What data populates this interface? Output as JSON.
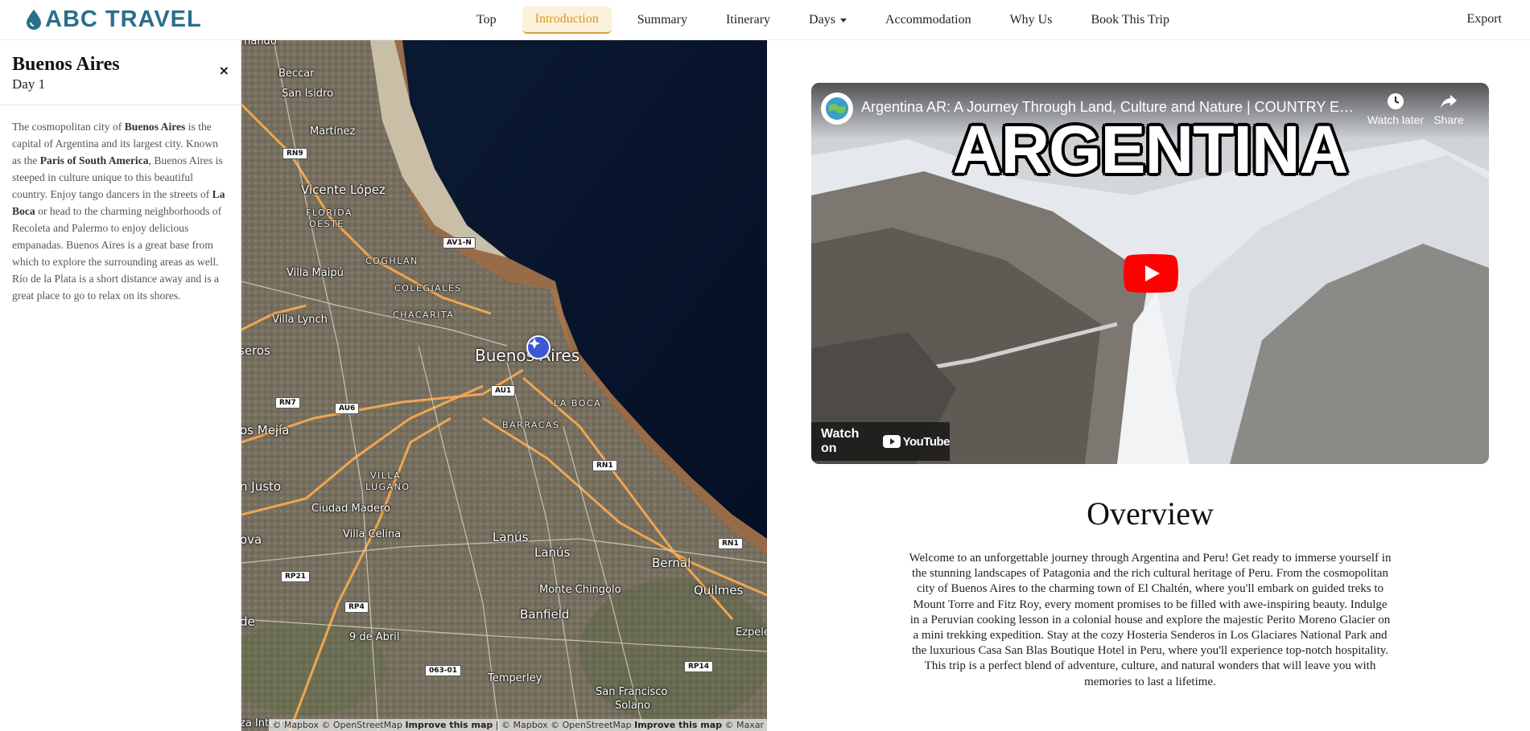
{
  "brand": {
    "name": "ABC TRAVEL",
    "color": "#2b6e8c"
  },
  "nav": {
    "items": [
      {
        "label": "Top"
      },
      {
        "label": "Introduction",
        "active": true
      },
      {
        "label": "Summary"
      },
      {
        "label": "Itinerary"
      },
      {
        "label": "Days",
        "dropdown": true
      },
      {
        "label": "Accommodation"
      },
      {
        "label": "Why Us"
      },
      {
        "label": "Book This Trip"
      }
    ],
    "export_label": "Export",
    "accent": "#d9a33a"
  },
  "sidebar": {
    "title": "Buenos Aires",
    "day": "Day 1",
    "close_symbol": "×",
    "description": {
      "p1": "The cosmopolitan city of ",
      "b1": "Buenos Aires",
      "p2": " is the capital of Argentina and its largest city. Known as the ",
      "b2": "Paris of South America",
      "p3": ", Buenos Aires is steeped in culture unique to this beautiful country. Enjoy tango dancers in the streets of ",
      "b3": "La Boca",
      "p4": " or head to the charming neighborhoods of Recoleta and Palermo to enjoy delicious empanadas. Buenos Aires is a great base from which to explore the surrounding areas as well. Río de la Plata is a short distance away and is a great place to go to relax on its shores."
    }
  },
  "map": {
    "labels": {
      "nando": "rnando",
      "beccar": "Beccar",
      "san_isidro": "San Isidro",
      "martinez": "Martínez",
      "vicente_lopez": "Vicente López",
      "florida_oeste_1": "FLORIDA",
      "florida_oeste_2": "OESTE",
      "villa_maipu": "Villa Maipú",
      "coghlan": "COGHLAN",
      "colegiales": "COLEGIALES",
      "chacarita": "CHACARITA",
      "villa_lynch": "Villa Lynch",
      "seros": "seros",
      "buenos_aires": "Buenos Aires",
      "la_boca": "LA BOCA",
      "barracas": "BARRACAS",
      "os_mejia": "os Mejía",
      "n_justo": "n Justo",
      "villa_lugano_1": "VILLA",
      "villa_lugano_2": "LUGANO",
      "ciudad_madero": "Ciudad Madero",
      "villa_celina": "Villa Celina",
      "ova": "ova",
      "lanus_1": "Lanús",
      "lanus_2": "Lanús",
      "bernal": "Bernal",
      "quilmes": "Quilmes",
      "monte_chingolo": "Monte Chingolo",
      "de": "de",
      "banfield": "Banfield",
      "nueve_de_abril": "9 de Abril",
      "ezpeleta": "Ezpele",
      "temperley": "Temperley",
      "san_francisco_solano_1": "San Francisco",
      "san_francisco_solano_2": "Solano",
      "internac": "za Internac"
    },
    "shields": {
      "rn9": "RN9",
      "av1n": "AV1-N",
      "rn7": "RN7",
      "au6": "AU6",
      "au1": "AU1",
      "rn1a": "RN1",
      "rn1b": "RN1",
      "rp21": "RP21",
      "rp4": "RP4",
      "r06301": "063-01",
      "rp14": "RP14"
    },
    "attribution": {
      "a1": "© Mapbox © OpenStreetMap ",
      "improve1": "Improve this map",
      "a2": " | © Mapbox © OpenStreetMap ",
      "improve2": "Improve this map",
      "a3": " © Maxar"
    }
  },
  "video": {
    "title": "Argentina AR: A Journey Through Land, Culture and Nature | COUNTRY EXP...",
    "overlay_title": "ARGENTINA",
    "watch_later": "Watch later",
    "share": "Share",
    "watch_on": "Watch on",
    "youtube": "YouTube",
    "play_color": "#ff0000"
  },
  "overview": {
    "title": "Overview",
    "text": "Welcome to an unforgettable journey through Argentina and Peru! Get ready to immerse yourself in the stunning landscapes of Patagonia and the rich cultural heritage of Peru. From the cosmopolitan city of Buenos Aires to the charming town of El Chaltén, where you'll embark on guided treks to Mount Torre and Fitz Roy, every moment promises to be filled with awe-inspiring beauty. Indulge in a Peruvian cooking lesson in a colonial house and explore the majestic Perito Moreno Glacier on a mini trekking expedition. Stay at the cozy Hosteria Senderos in Los Glaciares National Park and the luxurious Casa San Blas Boutique Hotel in Peru, where you'll experience top-notch hospitality. This trip is a perfect blend of adventure, culture, and natural wonders that will leave you with memories to last a lifetime."
  }
}
